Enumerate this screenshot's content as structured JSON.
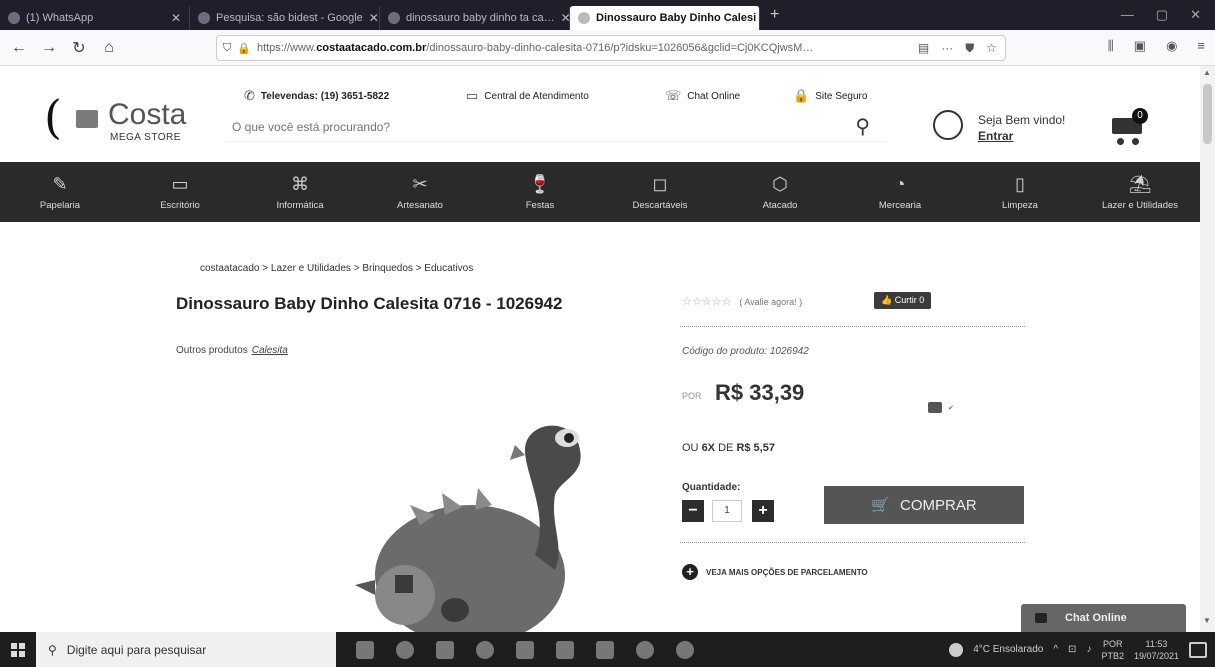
{
  "browser": {
    "tabs": [
      {
        "label": "(1) WhatsApp",
        "active": false
      },
      {
        "label": "Pesquisa: são bidest - Google",
        "active": false
      },
      {
        "label": "dinossauro baby dinho ta ca…",
        "active": false
      },
      {
        "label": "Dinossauro Baby Dinho Calesi",
        "active": true
      }
    ],
    "url_prefix": "https://www.",
    "url_domain": "costaatacado.com.br",
    "url_path": "/dinossauro-baby-dinho-calesita-0716/p?idsku=1026056&gclid=Cj0KCQjwsM…",
    "menu_dots": "···"
  },
  "site": {
    "logo_name": "Costa",
    "logo_sub": "MEGA STORE",
    "televendas": "Televendas: (19) 3651-5822",
    "central": "Central de Atendimento",
    "chat": "Chat Online",
    "site_seguro": "Site Seguro",
    "search_placeholder": "O que você está procurando?",
    "greeting": "Seja Bem vindo!",
    "login": "Entrar",
    "cart_count": "0",
    "categories": [
      {
        "label": "Papelaria",
        "icon": "✎"
      },
      {
        "label": "Escritório",
        "icon": "▭"
      },
      {
        "label": "Informática",
        "icon": "⌘"
      },
      {
        "label": "Artesanato",
        "icon": "✂"
      },
      {
        "label": "Festas",
        "icon": "🍷"
      },
      {
        "label": "Descartáveis",
        "icon": "◻"
      },
      {
        "label": "Atacado",
        "icon": "⬡"
      },
      {
        "label": "Mercearia",
        "icon": "◔"
      },
      {
        "label": "Limpeza",
        "icon": "▯"
      },
      {
        "label": "Lazer e Utilidades",
        "icon": "⛱"
      }
    ]
  },
  "product": {
    "breadcrumb": "costaatacado > Lazer e Utilidades > Brinquedos > Educativos",
    "title": "Dinossauro Baby Dinho Calesita 0716 - 1026942",
    "others_label": "Outros produtos",
    "brand": "Calesita",
    "rating_stars": "☆☆☆☆☆",
    "rating_label": "( Avalie agora! )",
    "like_label": "Curtir 0",
    "code": "Código do produto: 1026942",
    "price_prefix": "POR",
    "price": "R$ 33,39",
    "installment_prefix": "OU",
    "installment_count": "6X",
    "installment_of": "DE",
    "installment_value": "R$ 5,57",
    "quantity_label": "Quantidade:",
    "quantity": "1",
    "buy_label": "COMPRAR",
    "more_installments": "VEJA MAIS OPÇÕES DE PARCELAMENTO",
    "chat_online": "Chat Online"
  },
  "taskbar": {
    "search_placeholder": "Digite aqui para pesquisar",
    "weather": "4°C Ensolarado",
    "lang1": "POR",
    "lang2": "PTB2",
    "time": "11:53",
    "date": "19/07/2021"
  }
}
